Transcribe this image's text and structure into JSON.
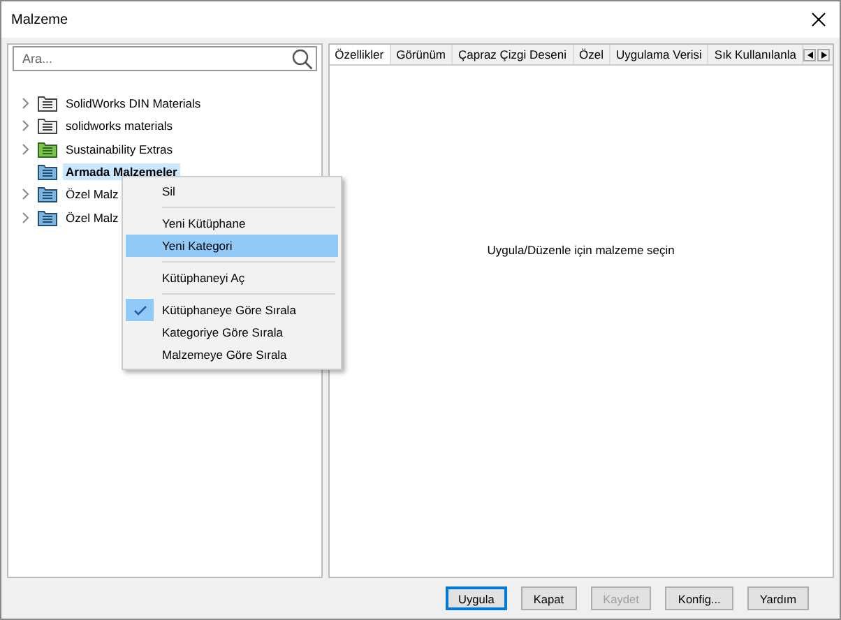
{
  "window": {
    "title": "Malzeme"
  },
  "search": {
    "placeholder": "Ara..."
  },
  "tree": [
    {
      "label": "SolidWorks DIN Materials",
      "kind": "plain",
      "has_children": true,
      "selected": false
    },
    {
      "label": "solidworks materials",
      "kind": "plain",
      "has_children": true,
      "selected": false
    },
    {
      "label": "Sustainability Extras",
      "kind": "green",
      "has_children": true,
      "selected": false
    },
    {
      "label": "Armada Malzemeler",
      "kind": "blue",
      "has_children": false,
      "selected": true
    },
    {
      "label": "Özel Malz",
      "kind": "blue",
      "has_children": true,
      "selected": false
    },
    {
      "label": "Özel Malz",
      "kind": "blue",
      "has_children": true,
      "selected": false
    }
  ],
  "context_menu": {
    "groups": [
      [
        {
          "label": "Sil",
          "highlighted": false,
          "checked": false
        }
      ],
      [
        {
          "label": "Yeni Kütüphane",
          "highlighted": false,
          "checked": false
        },
        {
          "label": "Yeni Kategori",
          "highlighted": true,
          "checked": false
        }
      ],
      [
        {
          "label": "Kütüphaneyi Aç",
          "highlighted": false,
          "checked": false
        }
      ],
      [
        {
          "label": "Kütüphaneye Göre Sırala",
          "highlighted": false,
          "checked": true
        },
        {
          "label": "Kategoriye Göre Sırala",
          "highlighted": false,
          "checked": false
        },
        {
          "label": "Malzemeye Göre Sırala",
          "highlighted": false,
          "checked": false
        }
      ]
    ]
  },
  "tabs": [
    {
      "label": "Özellikler",
      "selected": true
    },
    {
      "label": "Görünüm",
      "selected": false
    },
    {
      "label": "Çapraz Çizgi Deseni",
      "selected": false
    },
    {
      "label": "Özel",
      "selected": false
    },
    {
      "label": "Uygulama Verisi",
      "selected": false
    },
    {
      "label": "Sık Kullanılanla",
      "selected": false
    }
  ],
  "message": "Uygula/Düzenle için malzeme seçin",
  "buttons": [
    {
      "label": "Uygula",
      "default": true,
      "disabled": false
    },
    {
      "label": "Kapat",
      "default": false,
      "disabled": false
    },
    {
      "label": "Kaydet",
      "default": false,
      "disabled": true
    },
    {
      "label": "Konfig...",
      "default": false,
      "disabled": false
    },
    {
      "label": "Yardım",
      "default": false,
      "disabled": false
    }
  ]
}
